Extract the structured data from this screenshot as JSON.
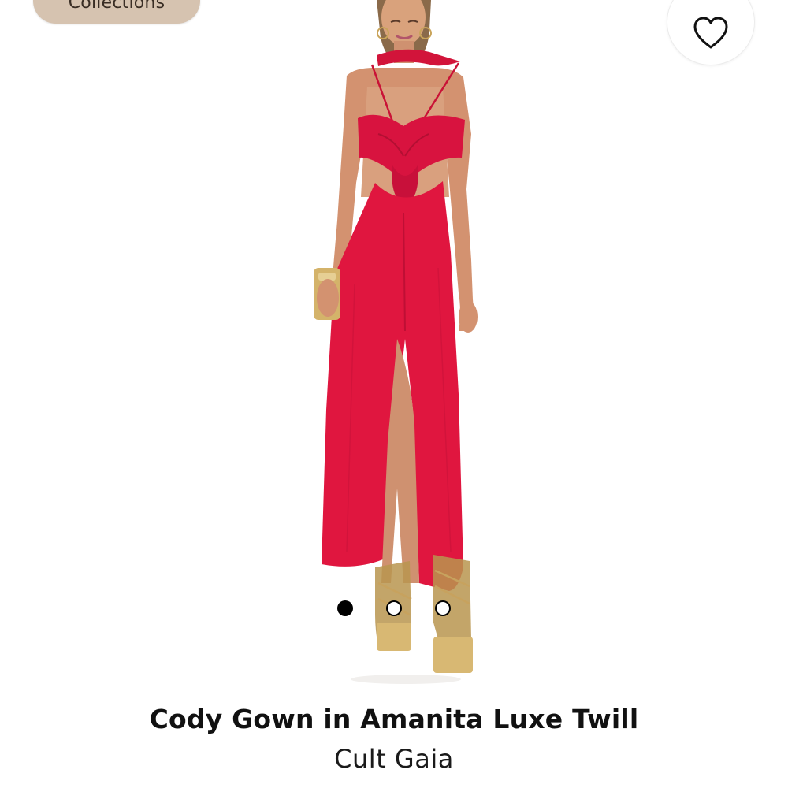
{
  "collections_button": {
    "label": "Collections"
  },
  "favorite_button": {
    "icon": "heart-icon"
  },
  "product": {
    "title": "Cody Gown in Amanita Luxe Twill",
    "brand": "Cult Gaia",
    "dress_color": "#e0163f",
    "image_count": 3,
    "active_image": 1
  },
  "colors": {
    "pill_background": "#d6c3b0",
    "dot_active": "#000000",
    "dot_inactive": "#ffffff"
  }
}
